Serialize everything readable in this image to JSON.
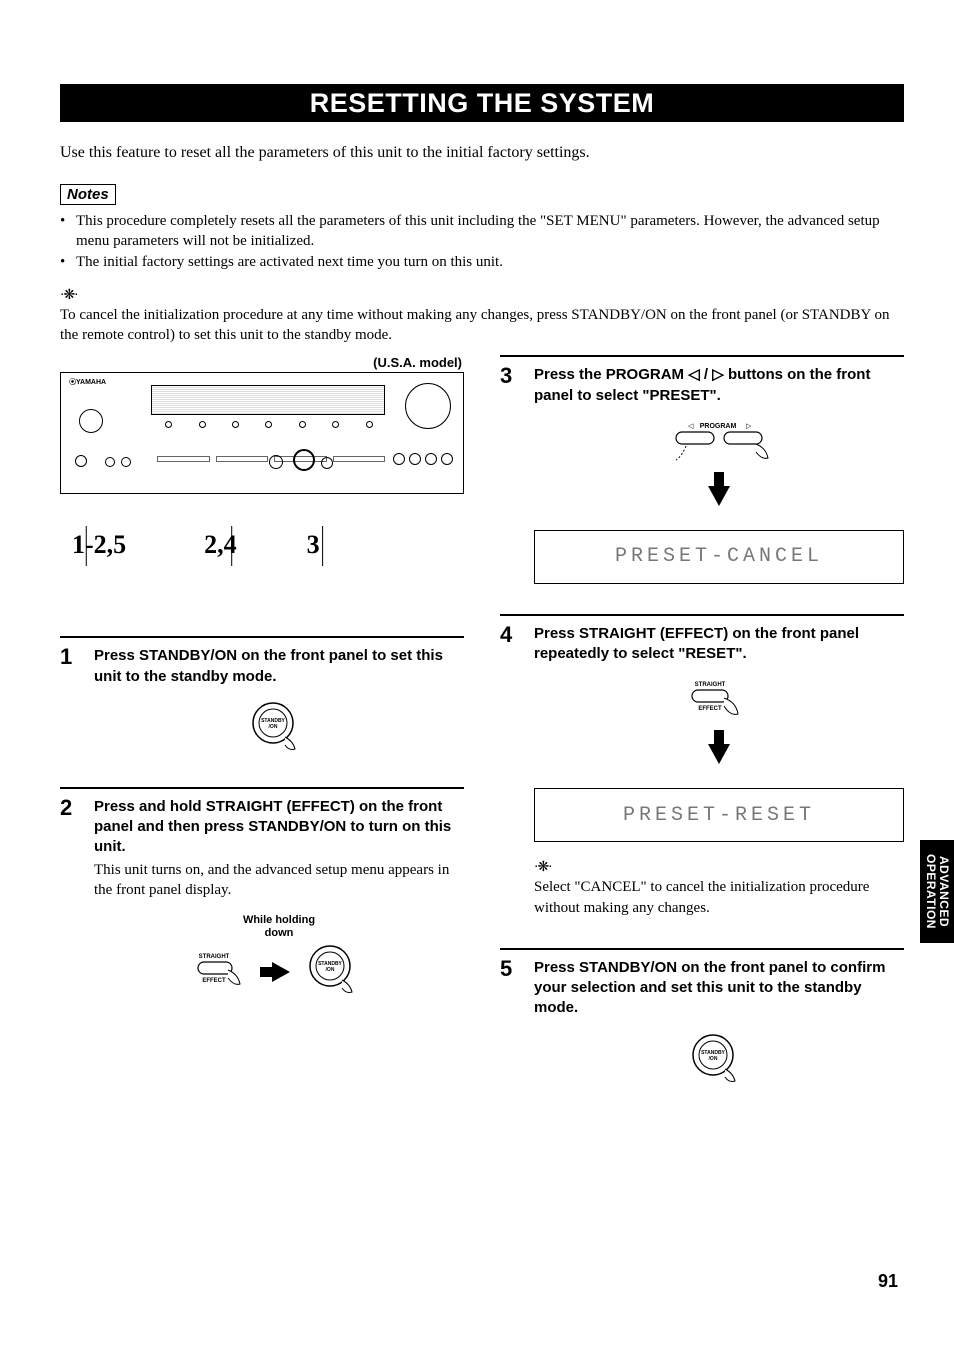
{
  "title": "RESETTING THE SYSTEM",
  "intro": "Use this feature to reset all the parameters of this unit to the initial factory settings.",
  "notes_label": "Notes",
  "notes": [
    "This procedure completely resets all the parameters of this unit including the \"SET MENU\" parameters. However, the advanced setup menu parameters will not be initialized.",
    "The initial factory settings are activated next time you turn on this unit."
  ],
  "cancel_tip": "To cancel the initialization procedure at any time without making any changes, press STANDBY/ON on the front panel (or STANDBY on the remote control) to set this unit to the standby mode.",
  "model_label": "(U.S.A. model)",
  "callouts": [
    "1-2,5",
    "2,4",
    "3"
  ],
  "steps": {
    "s1": {
      "num": "1",
      "bold": "Press STANDBY/ON on the front panel to set this unit to the standby mode.",
      "btn_label": "STANDBY\n/ON"
    },
    "s2": {
      "num": "2",
      "bold": "Press and hold STRAIGHT (EFFECT) on the front panel and then press STANDBY/ON to turn on this unit.",
      "plain": "This unit turns on, and the advanced setup menu appears in the front panel display.",
      "caption": "While holding\ndown",
      "straight_label": "STRAIGHT",
      "effect_label": "EFFECT",
      "standby_label": "STANDBY\n/ON"
    },
    "s3": {
      "num": "3",
      "bold_pre": "Press the PROGRAM ",
      "bold_post": " buttons on the front panel to select \"PRESET\".",
      "program_label": "PROGRAM",
      "display": "PRESET-CANCEL"
    },
    "s4": {
      "num": "4",
      "bold": "Press STRAIGHT (EFFECT) on the front panel repeatedly to select \"RESET\".",
      "straight_label": "STRAIGHT",
      "effect_label": "EFFECT",
      "display": "PRESET-RESET",
      "tip": "Select \"CANCEL\" to cancel the initialization procedure without making any changes."
    },
    "s5": {
      "num": "5",
      "bold": "Press STANDBY/ON on the front panel to confirm your selection and set this unit to the standby mode.",
      "btn_label": "STANDBY\n/ON"
    }
  },
  "side_tab": "ADVANCED\nOPERATION",
  "page_number": "91",
  "brand": "YAMAHA"
}
